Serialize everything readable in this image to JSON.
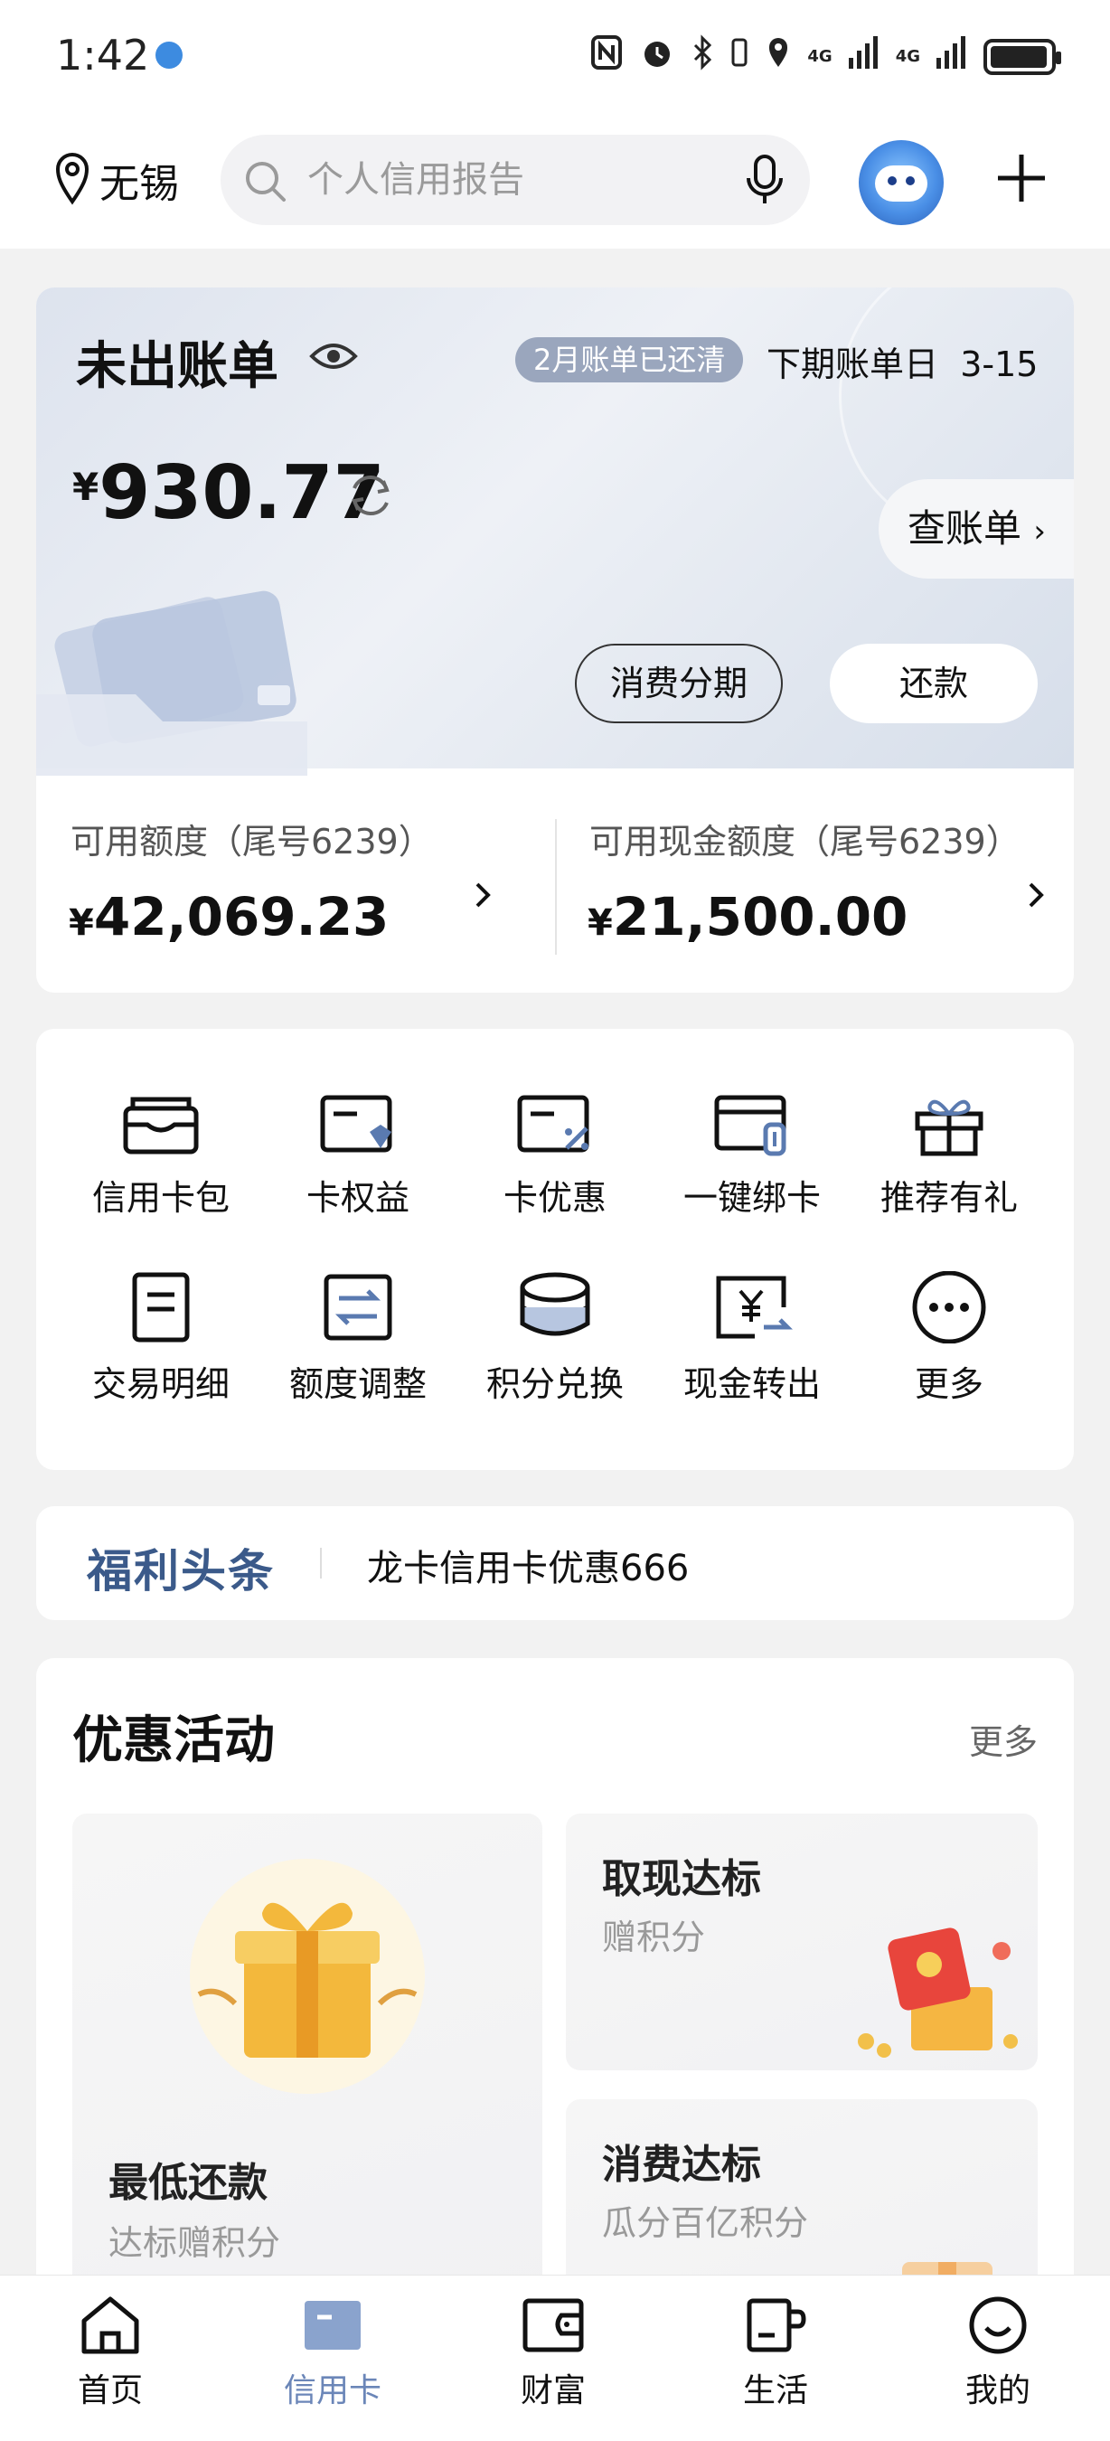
{
  "status_bar": {
    "time": "1:42",
    "network_1": "4G",
    "network_2": "4G"
  },
  "header": {
    "location": "无锡",
    "search_placeholder": "个人信用报告"
  },
  "bill": {
    "title": "未出账单",
    "paid_badge": "2月账单已还清",
    "next_bill_label": "下期账单日",
    "next_bill_date": "3-15",
    "currency": "¥",
    "amount": "930.77",
    "view_bill": "查账单",
    "installment_button": "消费分期",
    "repay_button": "还款",
    "limits": [
      {
        "label": "可用额度（尾号6239）",
        "currency": "¥",
        "value": "42,069.23"
      },
      {
        "label": "可用现金额度（尾号6239）",
        "currency": "¥",
        "value": "21,500.00"
      }
    ]
  },
  "functions": [
    {
      "label": "信用卡包",
      "icon": "card-wallet-icon"
    },
    {
      "label": "卡权益",
      "icon": "card-rights-icon"
    },
    {
      "label": "卡优惠",
      "icon": "card-discount-icon"
    },
    {
      "label": "一键绑卡",
      "icon": "bind-card-icon"
    },
    {
      "label": "推荐有礼",
      "icon": "gift-icon"
    },
    {
      "label": "交易明细",
      "icon": "document-icon"
    },
    {
      "label": "额度调整",
      "icon": "adjust-limit-icon"
    },
    {
      "label": "积分兑换",
      "icon": "coins-icon"
    },
    {
      "label": "现金转出",
      "icon": "cash-out-icon"
    },
    {
      "label": "更多",
      "icon": "more-icon"
    }
  ],
  "welfare": {
    "logo": "福利头条",
    "headline": "龙卡信用卡优惠666"
  },
  "promotions": {
    "title": "优惠活动",
    "more": "更多",
    "cards": [
      {
        "title": "最低还款",
        "subtitle": "达标赠积分"
      },
      {
        "title": "取现达标",
        "subtitle": "赠积分"
      },
      {
        "title": "消费达标",
        "subtitle": "瓜分百亿积分"
      }
    ]
  },
  "bottom_nav": [
    {
      "label": "首页",
      "icon": "home-icon"
    },
    {
      "label": "信用卡",
      "icon": "credit-card-icon"
    },
    {
      "label": "财富",
      "icon": "wallet-icon"
    },
    {
      "label": "生活",
      "icon": "cup-icon"
    },
    {
      "label": "我的",
      "icon": "smile-icon"
    }
  ],
  "colors": {
    "accent": "#6b86b8",
    "badge": "#9aa6bd",
    "page_bg": "#f2f2f2"
  }
}
